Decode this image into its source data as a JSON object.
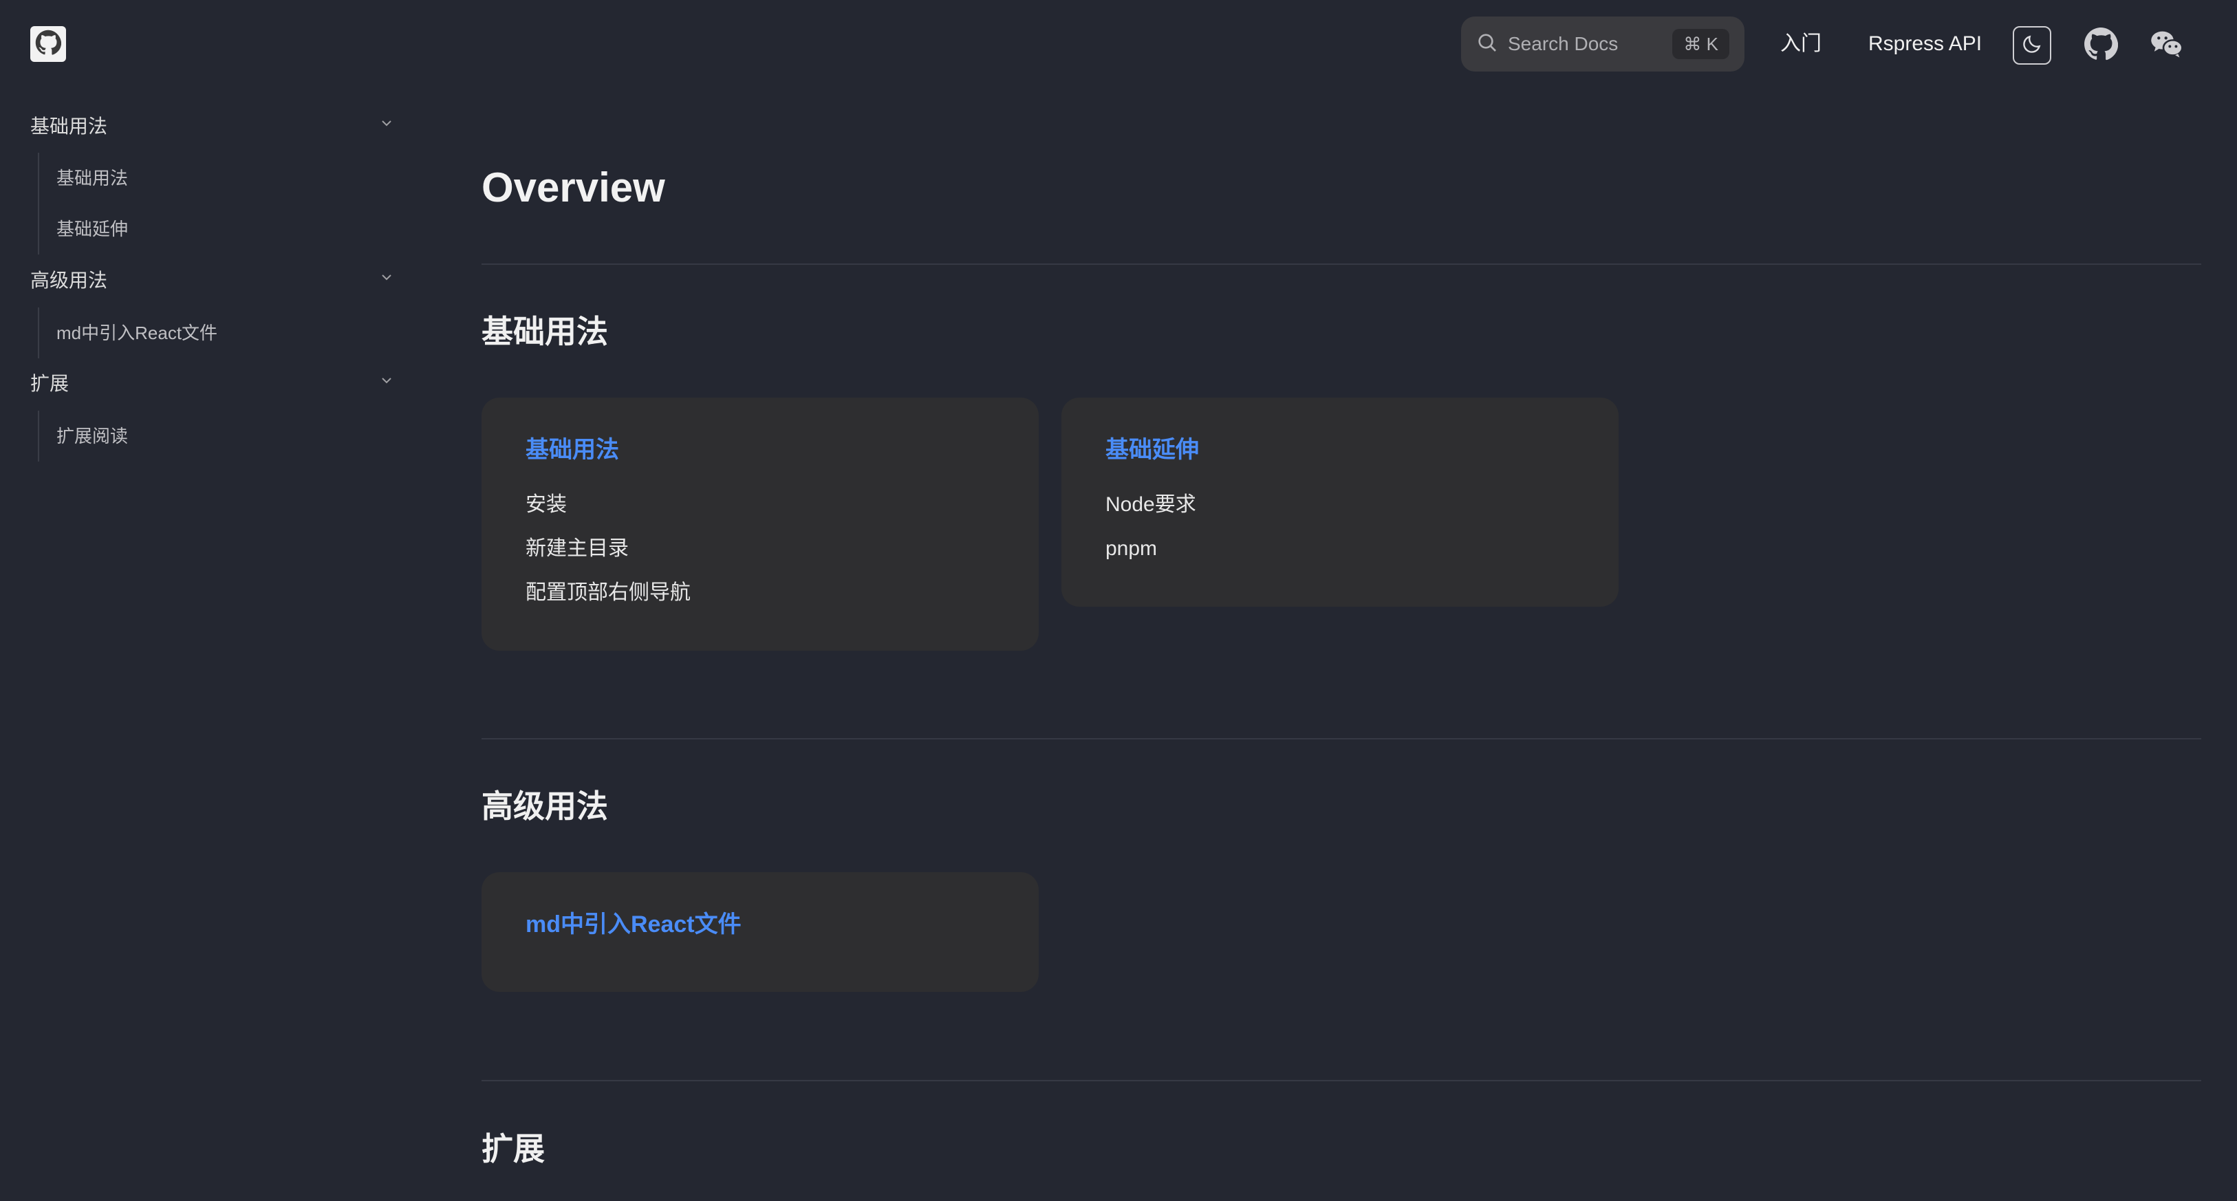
{
  "header": {
    "search_label": "Search Docs",
    "search_shortcut": "⌘ K",
    "nav_links": [
      {
        "label": "入门"
      },
      {
        "label": "Rspress API"
      }
    ],
    "icons": [
      "logo-github-icon",
      "search-icon",
      "moon-icon",
      "github-icon",
      "wechat-icon"
    ]
  },
  "sidebar": {
    "groups": [
      {
        "label": "基础用法",
        "items": [
          "基础用法",
          "基础延伸"
        ]
      },
      {
        "label": "高级用法",
        "items": [
          "md中引入React文件"
        ]
      },
      {
        "label": "扩展",
        "items": [
          "扩展阅读"
        ]
      }
    ]
  },
  "main": {
    "title": "Overview",
    "sections": [
      {
        "title": "基础用法",
        "cards": [
          {
            "title": "基础用法",
            "links": [
              "安装",
              "新建主目录",
              "配置顶部右侧导航"
            ]
          },
          {
            "title": "基础延伸",
            "links": [
              "Node要求",
              "pnpm"
            ]
          }
        ]
      },
      {
        "title": "高级用法",
        "cards": [
          {
            "title": "md中引入React文件",
            "links": []
          }
        ]
      },
      {
        "title": "扩展",
        "cards": []
      }
    ]
  },
  "colors": {
    "background": "#242731",
    "card": "#2e2e30",
    "accent_link": "#4a8cf7"
  }
}
